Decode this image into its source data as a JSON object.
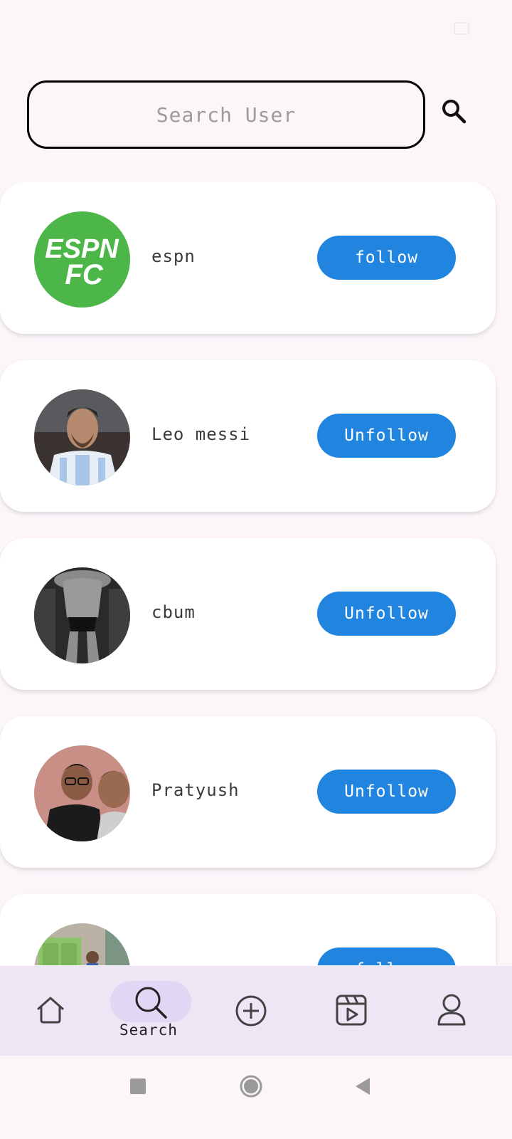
{
  "search": {
    "placeholder": "Search User",
    "value": ""
  },
  "users": [
    {
      "name": "espn",
      "action": "follow",
      "avatar": "espn-fc-logo"
    },
    {
      "name": "Leo messi",
      "action": "Unfollow",
      "avatar": "portrait-photo"
    },
    {
      "name": "cbum",
      "action": "Unfollow",
      "avatar": "bodybuilder-photo"
    },
    {
      "name": "Pratyush",
      "action": "Unfollow",
      "avatar": "friends-selfie"
    },
    {
      "name": "",
      "action": "follow",
      "avatar": "doorway-photo"
    }
  ],
  "nav": {
    "items": [
      "home-icon",
      "search-icon",
      "add-icon",
      "reels-icon",
      "profile-icon"
    ],
    "active_label": "Search"
  },
  "colors": {
    "accent": "#2185e0",
    "background": "#fcf6fb",
    "nav_bg": "#eee6f5",
    "nav_pill": "#e2d6f5",
    "espn_green": "#4cb748"
  },
  "logo": {
    "line1": "ESPN",
    "line2": "FC"
  }
}
